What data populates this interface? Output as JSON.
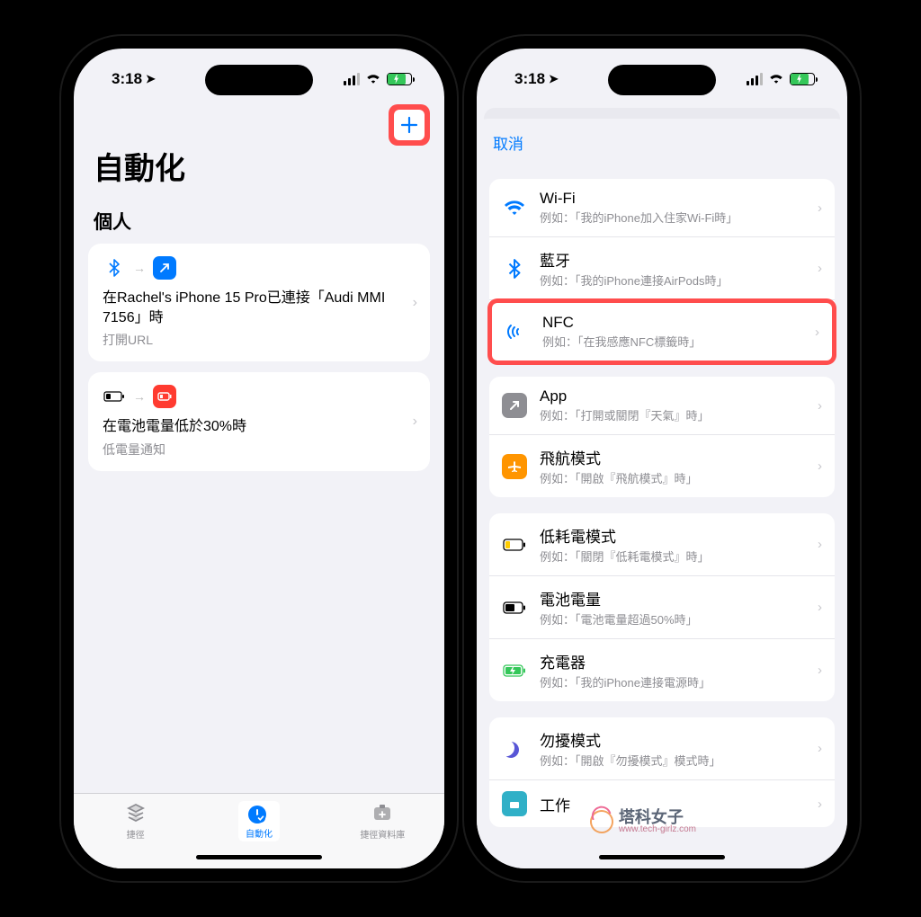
{
  "status": {
    "time": "3:18"
  },
  "left": {
    "title": "自動化",
    "section": "個人",
    "cards": [
      {
        "title": "在Rachel's iPhone 15 Pro已連接「Audi MMI 7156」時",
        "sub": "打開URL"
      },
      {
        "title": "在電池電量低於30%時",
        "sub": "低電量通知"
      }
    ],
    "tabs": {
      "shortcuts": "捷徑",
      "automation": "自動化",
      "gallery": "捷徑資料庫"
    }
  },
  "right": {
    "cancel": "取消",
    "triggers": {
      "wifi": {
        "title": "Wi-Fi",
        "sub": "例如：「我的iPhone加入住家Wi-Fi時」"
      },
      "bt": {
        "title": "藍牙",
        "sub": "例如：「我的iPhone連接AirPods時」"
      },
      "nfc": {
        "title": "NFC",
        "sub": "例如：「在我感應NFC標籤時」"
      },
      "app": {
        "title": "App",
        "sub": "例如：「打開或關閉『天氣』時」"
      },
      "airplane": {
        "title": "飛航模式",
        "sub": "例如：「開啟『飛航模式』時」"
      },
      "lowpower": {
        "title": "低耗電模式",
        "sub": "例如：「關閉『低耗電模式』時」"
      },
      "battery": {
        "title": "電池電量",
        "sub": "例如：「電池電量超過50%時」"
      },
      "charger": {
        "title": "充電器",
        "sub": "例如：「我的iPhone連接電源時」"
      },
      "dnd": {
        "title": "勿擾模式",
        "sub": "例如：「開啟『勿擾模式』模式時」"
      },
      "work": {
        "title": "工作",
        "sub": ""
      }
    }
  },
  "watermark": {
    "cn": "塔科女子",
    "url": "www.tech-girlz.com"
  }
}
